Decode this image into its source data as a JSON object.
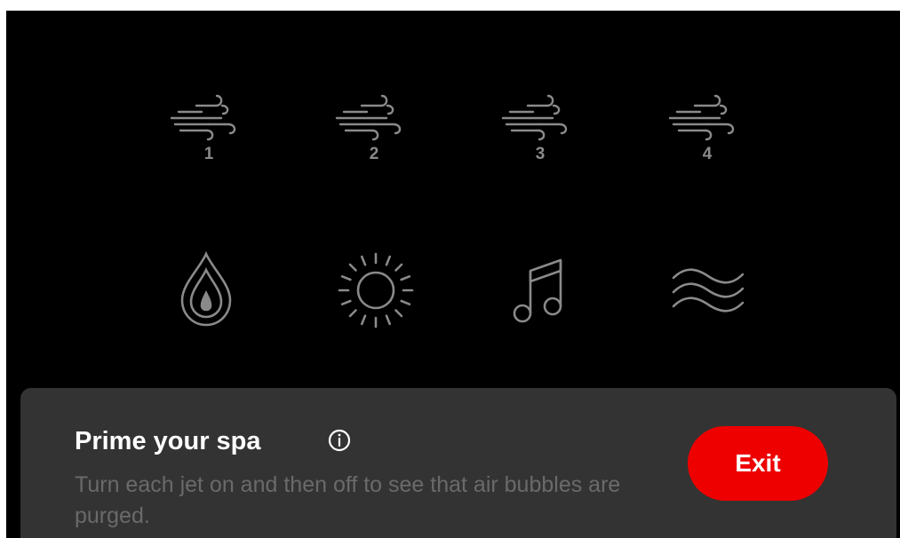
{
  "jets": [
    {
      "number": "1",
      "icon": "air-jet-icon"
    },
    {
      "number": "2",
      "icon": "air-jet-icon"
    },
    {
      "number": "3",
      "icon": "air-jet-icon"
    },
    {
      "number": "4",
      "icon": "air-jet-icon"
    }
  ],
  "controls": [
    {
      "icon": "water-drop-icon"
    },
    {
      "icon": "sun-light-icon"
    },
    {
      "icon": "music-note-icon"
    },
    {
      "icon": "waves-icon"
    }
  ],
  "prime_panel": {
    "title": "Prime your spa",
    "description": "Turn each jet on and then off to see that air bubbles are purged.",
    "exit_label": "Exit",
    "info_icon": "info-icon"
  },
  "colors": {
    "background": "#000000",
    "icon": "#8a8a8a",
    "panel": "#333333",
    "accent": "#ee0000",
    "description_text": "#6a6a6a"
  }
}
